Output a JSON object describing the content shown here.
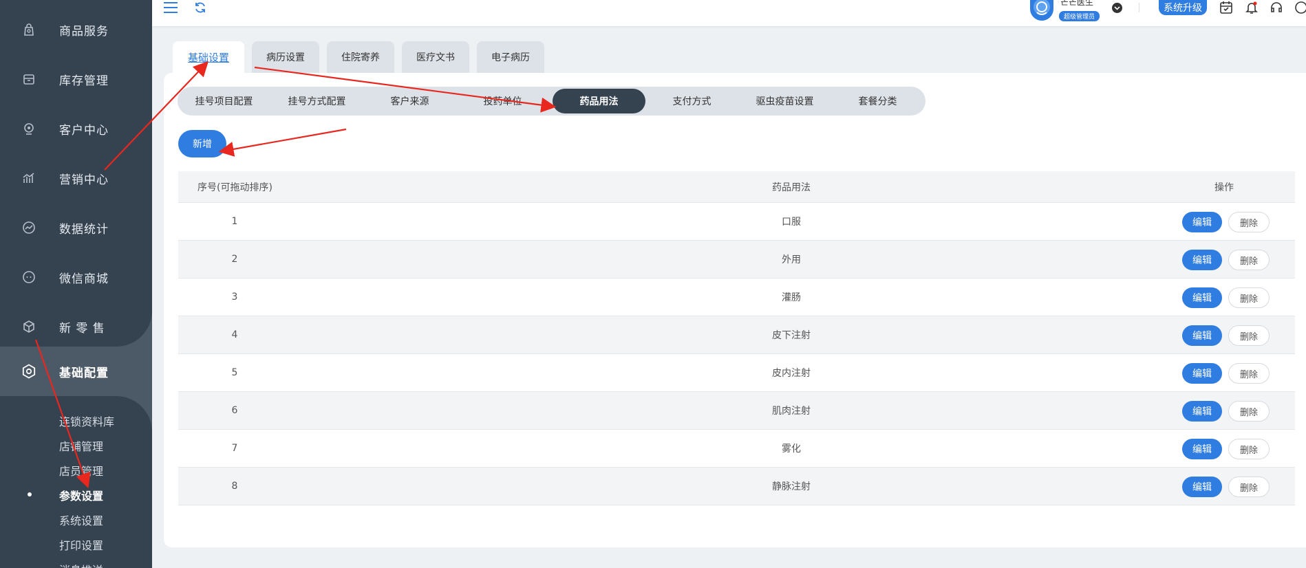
{
  "sidebar": {
    "items": [
      {
        "label": "商品服务",
        "icon": "bag-icon"
      },
      {
        "label": "库存管理",
        "icon": "inventory-icon"
      },
      {
        "label": "客户中心",
        "icon": "customer-icon"
      },
      {
        "label": "营销中心",
        "icon": "marketing-icon"
      },
      {
        "label": "数据统计",
        "icon": "statistics-icon"
      },
      {
        "label": "微信商城",
        "icon": "wechat-icon"
      },
      {
        "label": "新 零 售",
        "icon": "cube-icon"
      }
    ],
    "active": {
      "label": "基础配置",
      "icon": "settings-icon"
    },
    "sub_items": [
      "连锁资料库",
      "店铺管理",
      "店员管理",
      "参数设置",
      "系统设置",
      "打印设置",
      "消息推送"
    ]
  },
  "topbar": {
    "user_name": "芒芒医生",
    "user_role": "超级管理员",
    "upgrade_label": "系统升级"
  },
  "tabs": [
    "基础设置",
    "病历设置",
    "住院寄养",
    "医疗文书",
    "电子病历"
  ],
  "subtabs": [
    "挂号项目配置",
    "挂号方式配置",
    "客户来源",
    "投药单位",
    "药品用法",
    "支付方式",
    "驱虫疫苗设置",
    "套餐分类"
  ],
  "add_label": "新增",
  "table": {
    "headers": {
      "no": "序号(可拖动排序)",
      "usage": "药品用法",
      "op": "操作"
    },
    "rows": [
      {
        "no": "1",
        "usage": "口服"
      },
      {
        "no": "2",
        "usage": "外用"
      },
      {
        "no": "3",
        "usage": "灌肠"
      },
      {
        "no": "4",
        "usage": "皮下注射"
      },
      {
        "no": "5",
        "usage": "皮内注射"
      },
      {
        "no": "6",
        "usage": "肌肉注射"
      },
      {
        "no": "7",
        "usage": "雾化"
      },
      {
        "no": "8",
        "usage": "静脉注射"
      }
    ],
    "edit_label": "编辑",
    "delete_label": "删除"
  },
  "colors": {
    "accent": "#2f7de1",
    "sidebar": "#354250",
    "annotation": "#e8271f"
  }
}
